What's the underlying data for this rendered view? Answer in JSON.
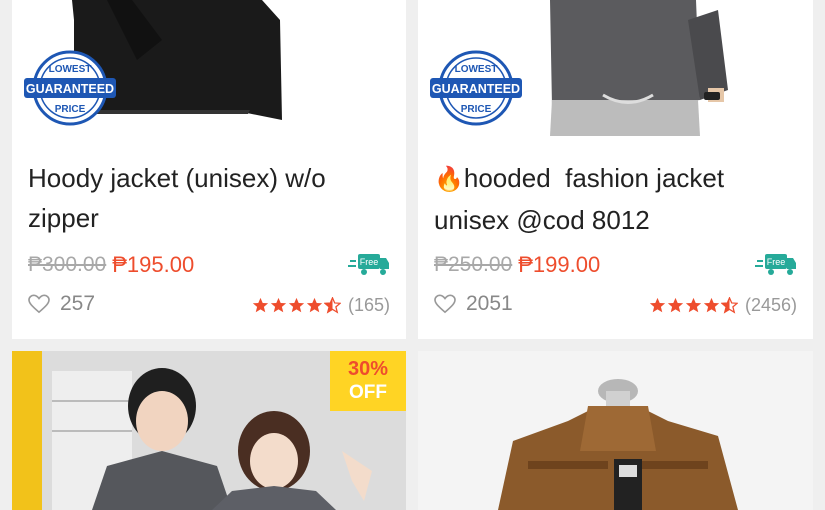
{
  "products": [
    {
      "title": "Hoody jacket (unisex) w/o zipper",
      "old_price": "₱300.00",
      "new_price": "₱195.00",
      "likes": "257",
      "rating": 4.5,
      "rating_count": "(165)",
      "badge": {
        "top": "LOWEST",
        "mid": "GUARANTEED",
        "bottom": "PRICE"
      },
      "free_label": "Free"
    },
    {
      "title_emoji": "🔥",
      "title": "hooded  fashion jacket unisex @cod 8012",
      "old_price": "₱250.00",
      "new_price": "₱199.00",
      "likes": "2051",
      "rating": 4.5,
      "rating_count": "(2456)",
      "badge": {
        "top": "LOWEST",
        "mid": "GUARANTEED",
        "bottom": "PRICE"
      },
      "free_label": "Free"
    },
    {
      "discount_pct": "30%",
      "discount_off": "OFF"
    },
    {}
  ],
  "colors": {
    "accent": "#ee4d2d",
    "badge_blue": "#1e57b4",
    "free_green": "#26aa99",
    "discount_yellow": "#ffd424"
  },
  "icons": [
    "heart-icon",
    "star-icon",
    "free-shipping-truck-icon",
    "lowest-price-badge-icon"
  ]
}
